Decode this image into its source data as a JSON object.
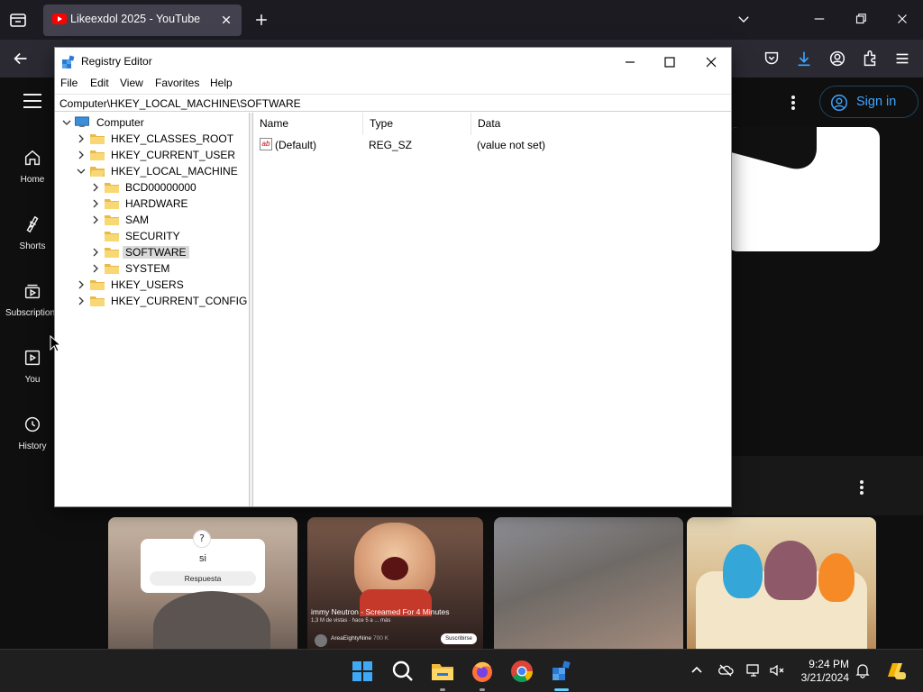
{
  "browser": {
    "tab_title": "Likeexdol 2025 - YouTube",
    "colors": {
      "tabstrip": "#1c1b22",
      "toolbar": "#2b2a33",
      "active_tab": "#42414d"
    }
  },
  "youtube": {
    "guide": [
      {
        "label": "Home",
        "icon": "home-icon"
      },
      {
        "label": "Shorts",
        "icon": "shorts-icon"
      },
      {
        "label": "Subscriptions",
        "icon": "subscriptions-icon"
      },
      {
        "label": "You",
        "icon": "you-icon"
      },
      {
        "label": "History",
        "icon": "history-icon"
      }
    ],
    "sign_in": "Sign in",
    "thumbs": {
      "t1": {
        "answer": "si",
        "label": "Respuesta"
      },
      "t2": {
        "title": "immy Neutron - Screamed For 4 Minutes",
        "meta": "1,3 M de vistas · hace 5 a ... más",
        "channel": "AreaEightyNine",
        "count": "700 K",
        "subscribe": "Suscribirse"
      }
    }
  },
  "regedit": {
    "title": "Registry Editor",
    "menu": [
      "File",
      "Edit",
      "View",
      "Favorites",
      "Help"
    ],
    "address": "Computer\\HKEY_LOCAL_MACHINE\\SOFTWARE",
    "tree": [
      {
        "label": "Computer",
        "level": 0,
        "expanded": true,
        "type": "computer"
      },
      {
        "label": "HKEY_CLASSES_ROOT",
        "level": 1,
        "expanded": false
      },
      {
        "label": "HKEY_CURRENT_USER",
        "level": 1,
        "expanded": false
      },
      {
        "label": "HKEY_LOCAL_MACHINE",
        "level": 1,
        "expanded": true
      },
      {
        "label": "BCD00000000",
        "level": 2,
        "expanded": false
      },
      {
        "label": "HARDWARE",
        "level": 2,
        "expanded": false
      },
      {
        "label": "SAM",
        "level": 2,
        "expanded": false
      },
      {
        "label": "SECURITY",
        "level": 2,
        "expanded": null
      },
      {
        "label": "SOFTWARE",
        "level": 2,
        "expanded": false,
        "selected": true
      },
      {
        "label": "SYSTEM",
        "level": 2,
        "expanded": false
      },
      {
        "label": "HKEY_USERS",
        "level": 1,
        "expanded": false
      },
      {
        "label": "HKEY_CURRENT_CONFIG",
        "level": 1,
        "expanded": false
      }
    ],
    "columns": [
      "Name",
      "Type",
      "Data"
    ],
    "values": [
      {
        "name": "(Default)",
        "type": "REG_SZ",
        "data": "(value not set)"
      }
    ]
  },
  "taskbar": {
    "time": "9:24 PM",
    "date": "3/21/2024",
    "apps": [
      "windows-start-icon",
      "search-icon",
      "file-explorer-icon",
      "firefox-icon",
      "chrome-icon",
      "registry-editor-icon"
    ]
  }
}
